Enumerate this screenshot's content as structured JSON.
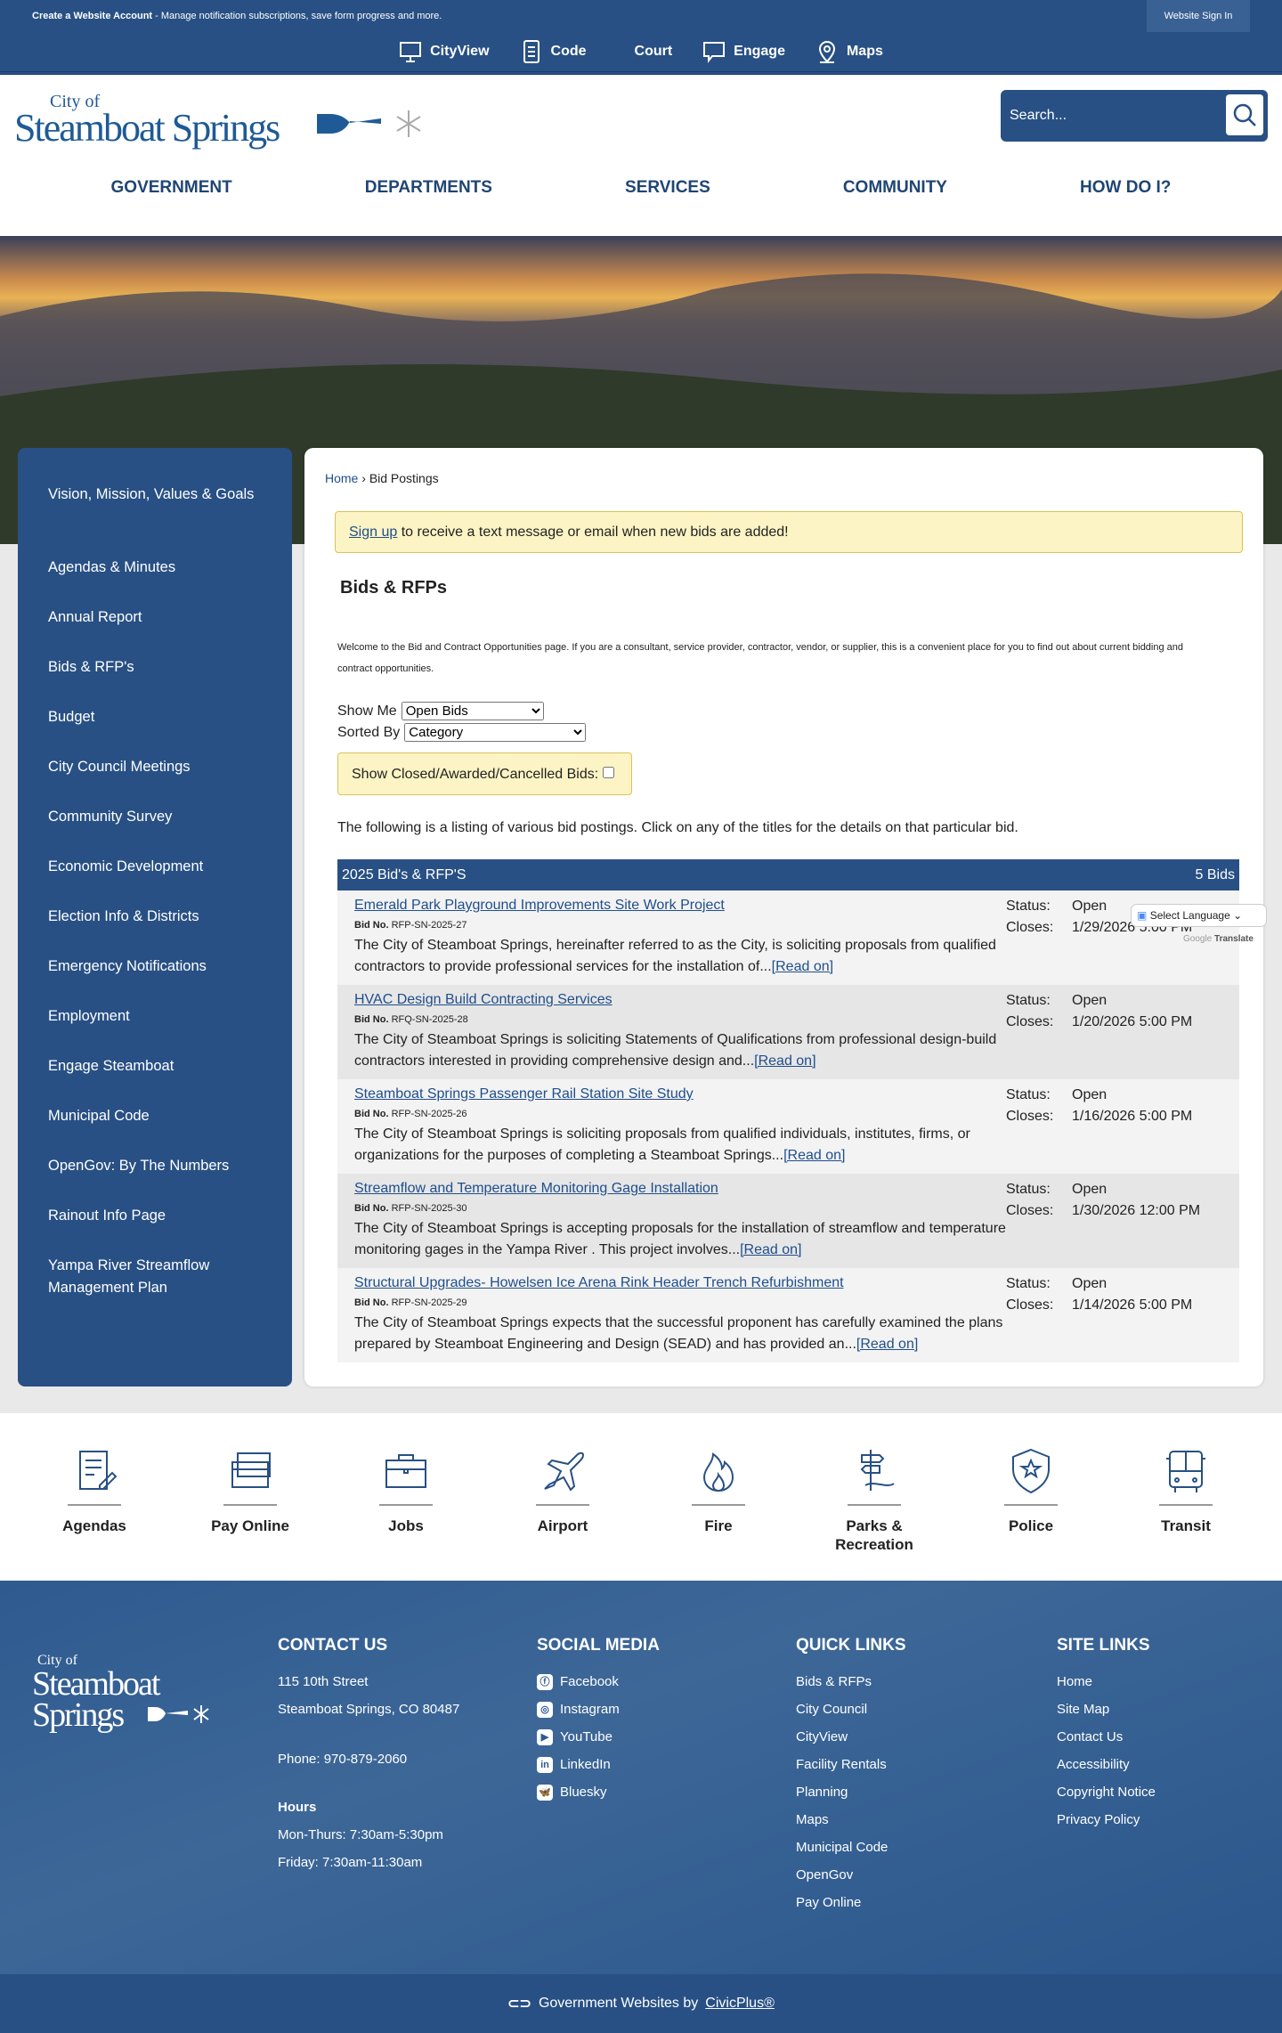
{
  "topbar": {
    "account_bold": "Create a Website Account",
    "account_rest": " - Manage notification subscriptions, save form progress and more.",
    "sign_in": "Website Sign In"
  },
  "quicknav": [
    {
      "label": "CityView",
      "icon": "monitor-icon"
    },
    {
      "label": "Code",
      "icon": "document-icon"
    },
    {
      "label": "Court",
      "icon": ""
    },
    {
      "label": "Engage",
      "icon": "chat-icon"
    },
    {
      "label": "Maps",
      "icon": "map-pin-icon"
    }
  ],
  "logo": {
    "line1": "City of",
    "line2": "Steamboat Springs"
  },
  "search": {
    "placeholder": "Search..."
  },
  "mainnav": [
    "GOVERNMENT",
    "DEPARTMENTS",
    "SERVICES",
    "COMMUNITY",
    "HOW DO I?"
  ],
  "sidebar": [
    "Vision, Mission, Values & Goals",
    "Agendas & Minutes",
    "Annual Report",
    "Bids & RFP's",
    "Budget",
    "City Council Meetings",
    "Community Survey",
    "Economic Development",
    "Election Info & Districts",
    "Emergency Notifications",
    "Employment",
    "Engage Steamboat",
    "Municipal Code",
    "OpenGov: By The Numbers",
    "Rainout Info Page",
    "Yampa River Streamflow Management Plan"
  ],
  "breadcrumb": {
    "home": "Home",
    "sep": " › ",
    "current": "Bid Postings"
  },
  "alert": {
    "link": "Sign up",
    "text": " to receive a text message or email when new bids are added!"
  },
  "page_title": "Bids & RFPs",
  "intro": "Welcome to the Bid and Contract Opportunities page. If you are a consultant, service provider, contractor, vendor, or supplier, this is a convenient place for you to find out about current bidding and contract opportunities.",
  "filters": {
    "show_me_label": "Show Me",
    "show_me_value": "Open Bids",
    "sorted_by_label": "Sorted By",
    "sorted_by_value": "Category",
    "closed_label": "Show Closed/Awarded/Cancelled Bids:"
  },
  "listing_text": "The following is a listing of various bid postings. Click on any of the titles for the details on that particular bid.",
  "table": {
    "title": "2025 Bid's & RFP'S",
    "count": "5 Bids",
    "bid_no_label": "Bid No.",
    "status_label": "Status:",
    "closes_label": "Closes:",
    "read_on": "[Read on]",
    "rows": [
      {
        "title": "Emerald Park Playground Improvements Site Work Project",
        "bid_no": "RFP-SN-2025-27",
        "desc": "The City of Steamboat Springs, hereinafter referred to as the City, is soliciting proposals from qualified contractors to provide professional services for the installation of...",
        "status": "Open",
        "closes": "1/29/2026 5:00 PM"
      },
      {
        "title": "HVAC Design Build Contracting Services",
        "bid_no": "RFQ-SN-2025-28",
        "desc": "The City of Steamboat Springs is soliciting Statements of Qualifications from professional design-build contractors interested in providing comprehensive design and...",
        "status": "Open",
        "closes": "1/20/2026 5:00 PM"
      },
      {
        "title": "Steamboat Springs Passenger Rail Station Site Study",
        "bid_no": "RFP-SN-2025-26",
        "desc": "The City of Steamboat Springs is soliciting proposals from qualified individuals, institutes, firms, or organizations for the purposes of completing a Steamboat Springs...",
        "status": "Open",
        "closes": "1/16/2026 5:00 PM"
      },
      {
        "title": "Streamflow and Temperature Monitoring Gage Installation",
        "bid_no": "RFP-SN-2025-30",
        "desc": "The City of Steamboat Springs is accepting proposals for the installation of streamflow and temperature monitoring gages in the Yampa River . This project involves...",
        "status": "Open",
        "closes": "1/30/2026 12:00 PM"
      },
      {
        "title": "Structural Upgrades- Howelsen Ice Arena Rink Header Trench Refurbishment",
        "bid_no": "RFP-SN-2025-29",
        "desc": "The City of Steamboat Springs expects that the successful proponent has carefully examined the plans prepared by Steamboat Engineering and Design (SEAD) and has provided an...",
        "status": "Open",
        "closes": "1/14/2026 5:00 PM"
      }
    ]
  },
  "translate": {
    "select": "Select Language",
    "powered": "Google",
    "translate": "Translate"
  },
  "quick_icons": [
    "Agendas",
    "Pay Online",
    "Jobs",
    "Airport",
    "Fire",
    "Parks & Recreation",
    "Police",
    "Transit"
  ],
  "footer": {
    "contact": {
      "heading": "CONTACT US",
      "street": "115 10th Street",
      "city": "Steamboat Springs, CO 80487",
      "phone": "Phone: 970-879-2060",
      "hours_heading": "Hours",
      "hours1": "Mon-Thurs: 7:30am-5:30pm",
      "hours2": "Friday: 7:30am-11:30am"
    },
    "social": {
      "heading": "SOCIAL MEDIA",
      "items": [
        "Facebook",
        "Instagram",
        "YouTube",
        "LinkedIn",
        "Bluesky"
      ]
    },
    "quick": {
      "heading": "QUICK LINKS",
      "items": [
        "Bids & RFPs",
        "City Council",
        "CityView",
        "Facility Rentals",
        "Planning",
        "Maps",
        "Municipal Code",
        "OpenGov",
        "Pay Online"
      ]
    },
    "site": {
      "heading": "SITE LINKS",
      "items": [
        "Home",
        "Site Map",
        "Contact Us",
        "Accessibility",
        "Copyright Notice",
        "Privacy Policy"
      ]
    }
  },
  "bottom": {
    "text": "Government Websites by",
    "link": "CivicPlus®"
  },
  "colors": {
    "primary": "#285084",
    "alert_bg": "#fcf4c4"
  }
}
